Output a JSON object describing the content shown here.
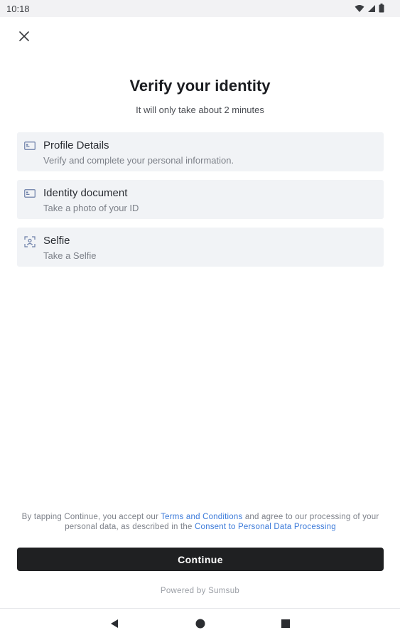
{
  "status_bar": {
    "time": "10:18",
    "icons": [
      "wifi-icon",
      "signal-icon",
      "battery-icon"
    ]
  },
  "header": {
    "close_icon": "close-icon",
    "title": "Verify your identity",
    "subtitle": "It will only take about 2 minutes"
  },
  "steps": [
    {
      "icon": "id-card-icon",
      "title": "Profile Details",
      "description": "Verify and complete your personal information."
    },
    {
      "icon": "id-card-icon",
      "title": "Identity document",
      "description": "Take a photo of your ID"
    },
    {
      "icon": "face-scan-icon",
      "title": "Selfie",
      "description": "Take a Selfie"
    }
  ],
  "consent": {
    "text_1": "By tapping Continue, you accept our ",
    "link_terms": "Terms and Conditions",
    "text_2": " and agree to our processing of your personal data, as described in the ",
    "link_consent": "Consent to Personal Data Processing"
  },
  "continue_label": "Continue",
  "powered_by": "Powered by Sumsub",
  "nav_bar": {
    "back_icon": "back-triangle-icon",
    "home_icon": "home-circle-icon",
    "recents_icon": "recents-square-icon"
  },
  "colors": {
    "button_bg": "#1f2022",
    "card_bg": "#f1f3f6",
    "link": "#3b7ad9"
  }
}
